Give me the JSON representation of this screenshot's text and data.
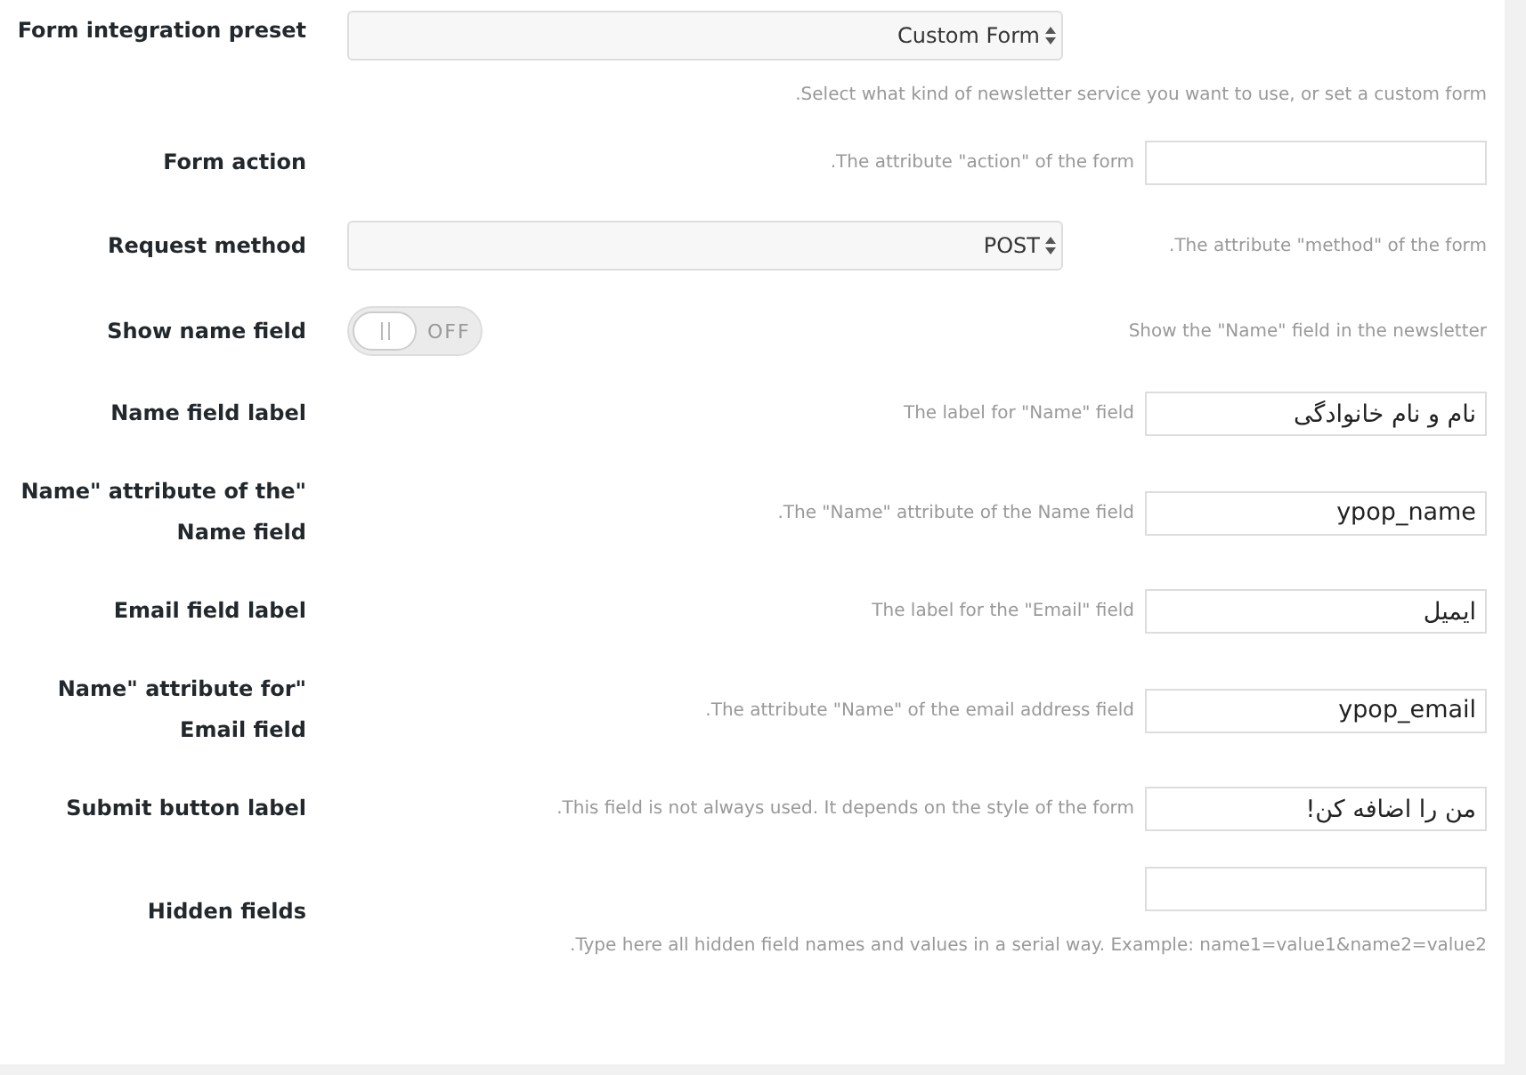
{
  "settings": [
    {
      "kind": "stackedselect",
      "label": "Form integration preset",
      "value": "Custom Form",
      "description": ".Select what kind of newsletter service you want to use, or set a custom form"
    },
    {
      "kind": "text",
      "label": "Form action",
      "description": ".The attribute \"action\" of the form"
    },
    {
      "kind": "select",
      "label": "Request method",
      "value": "POST",
      "description": ".The attribute \"method\" of the form"
    },
    {
      "kind": "toggle",
      "label": "Show name field",
      "on": false,
      "state_text": "OFF",
      "description": "Show the \"Name\" field in the newsletter"
    },
    {
      "kind": "text",
      "label": "Name field label",
      "value": "نام و نام خانوادگی",
      "description": "The label for \"Name\" field"
    },
    {
      "kind": "text",
      "label": "Name\" attribute of the\"\nName field",
      "value": "ypop_name",
      "description": ".The \"Name\" attribute of the Name field"
    },
    {
      "kind": "text",
      "label": "Email field label",
      "value": "ایمیل",
      "description": "The label for the \"Email\" field"
    },
    {
      "kind": "text",
      "label": "Name\" attribute for\"\nEmail field",
      "value": "ypop_email",
      "description": ".The attribute \"Name\" of the email address field"
    },
    {
      "kind": "text",
      "label": "Submit button label",
      "value": "من را اضافه کن!",
      "description": ".This field is not always used. It depends on the style of the form"
    },
    {
      "kind": "stackedtext",
      "label": "Hidden fields",
      "description": ".Type here all hidden field names and values in a serial way. Example: name1=value1&name2=value2"
    }
  ]
}
